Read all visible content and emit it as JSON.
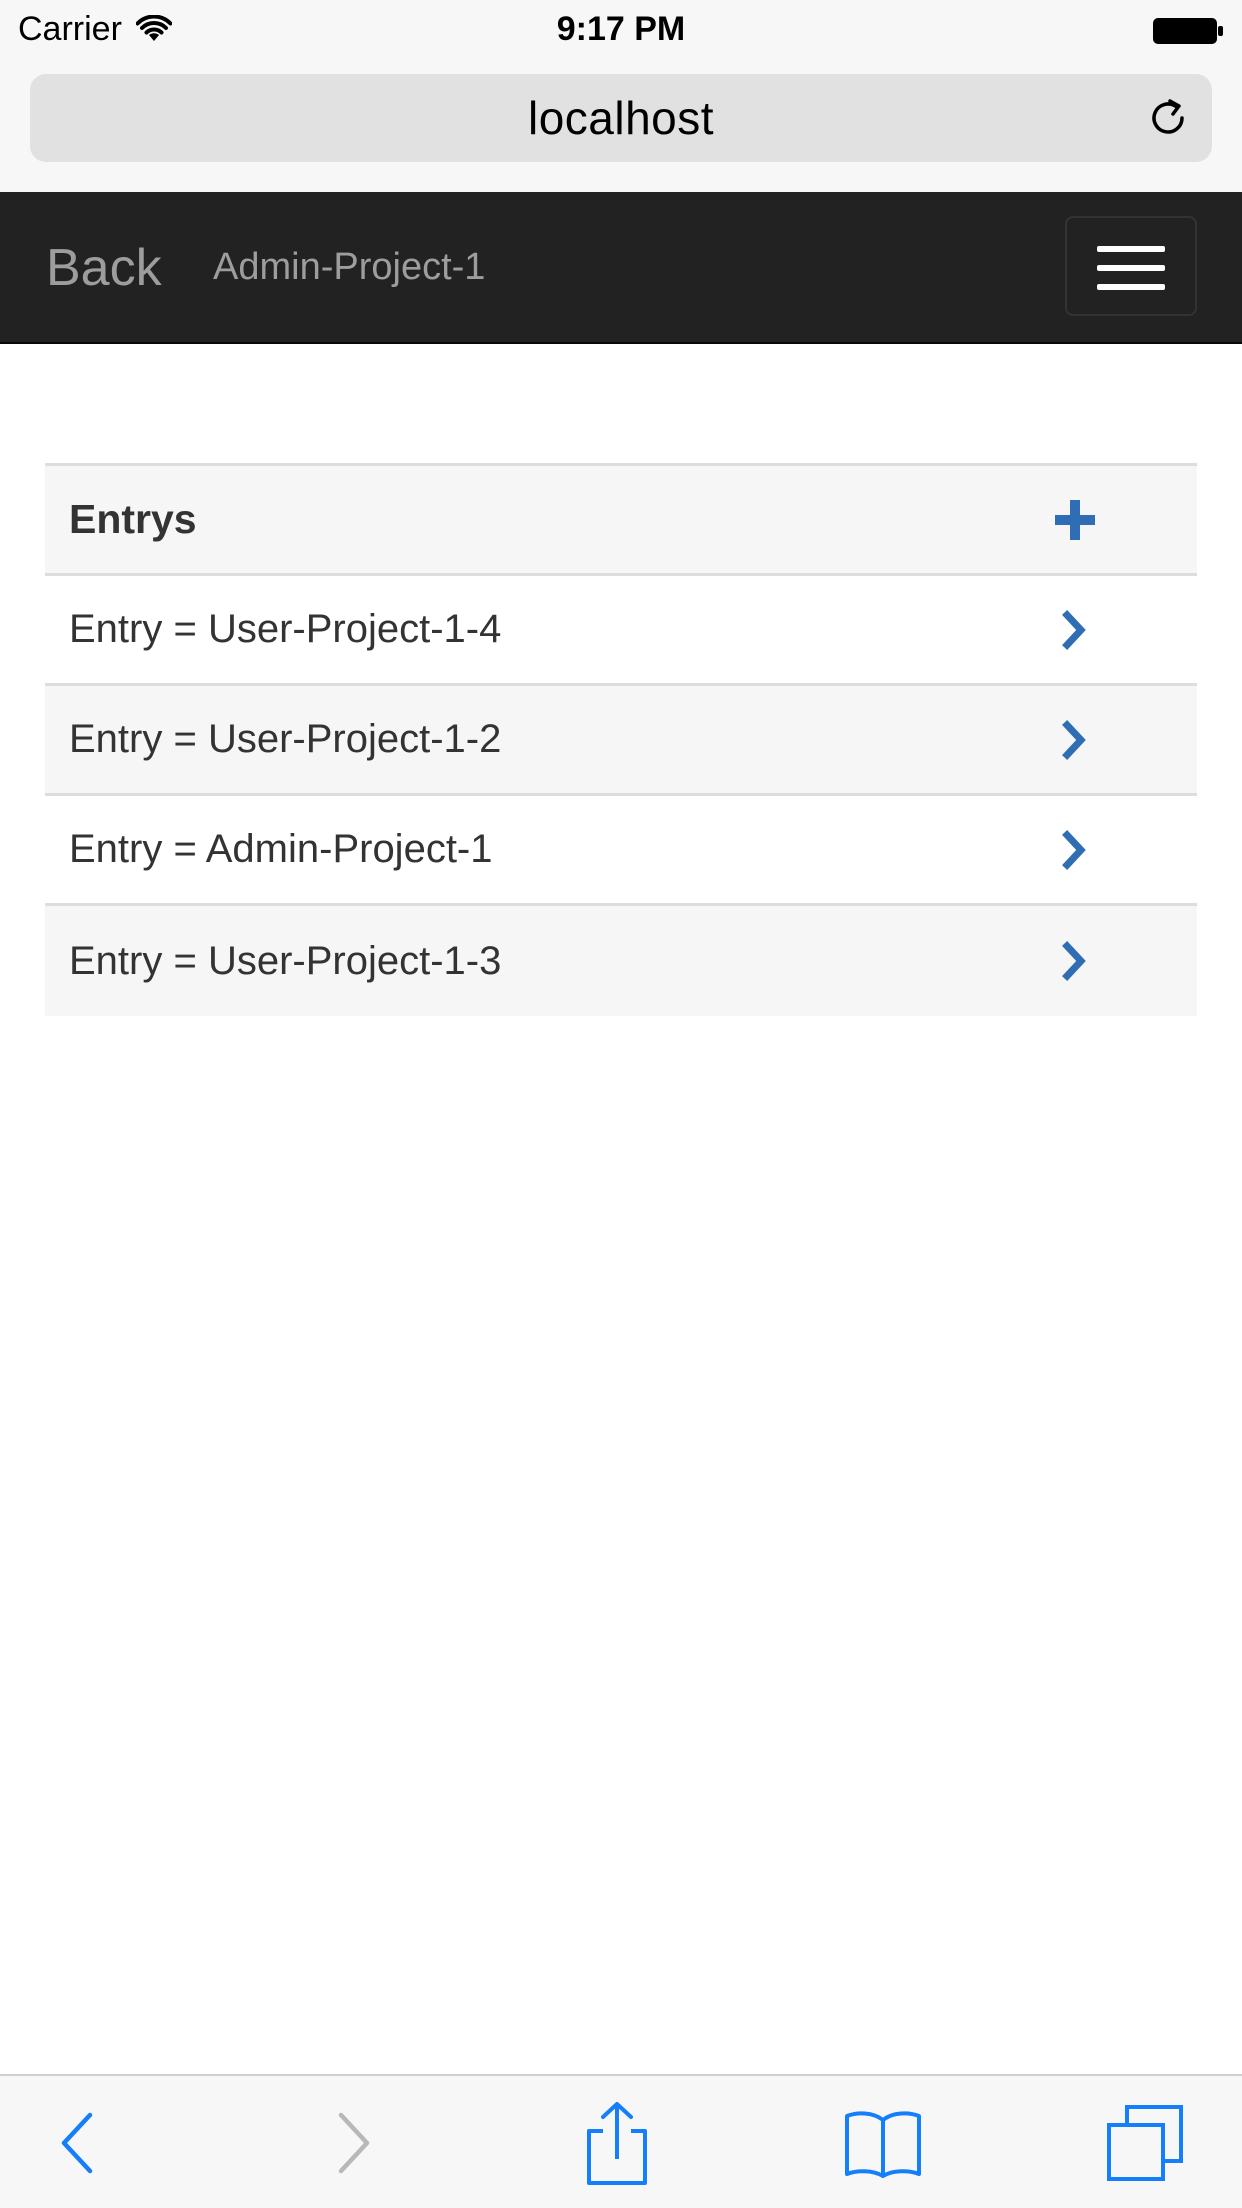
{
  "status_bar": {
    "carrier": "Carrier",
    "time": "9:17 PM"
  },
  "browser": {
    "url": "localhost"
  },
  "navbar": {
    "back_label": "Back",
    "title": "Admin-Project-1"
  },
  "table": {
    "header": "Entrys",
    "rows": [
      {
        "label": "Entry = User-Project-1-4"
      },
      {
        "label": "Entry = User-Project-1-2"
      },
      {
        "label": "Entry = Admin-Project-1"
      },
      {
        "label": "Entry = User-Project-1-3"
      }
    ]
  },
  "icons": {
    "accent": "#2f6db5",
    "ios_tint": "#147efb",
    "disabled": "#b8b8b8",
    "add": "plus-icon",
    "open_row": "chevron-right-icon",
    "menu": "hamburger-icon",
    "reload": "reload-icon",
    "toolbar": [
      "back-arrow-icon",
      "forward-arrow-icon",
      "share-icon",
      "bookmarks-icon",
      "tabs-icon"
    ]
  }
}
